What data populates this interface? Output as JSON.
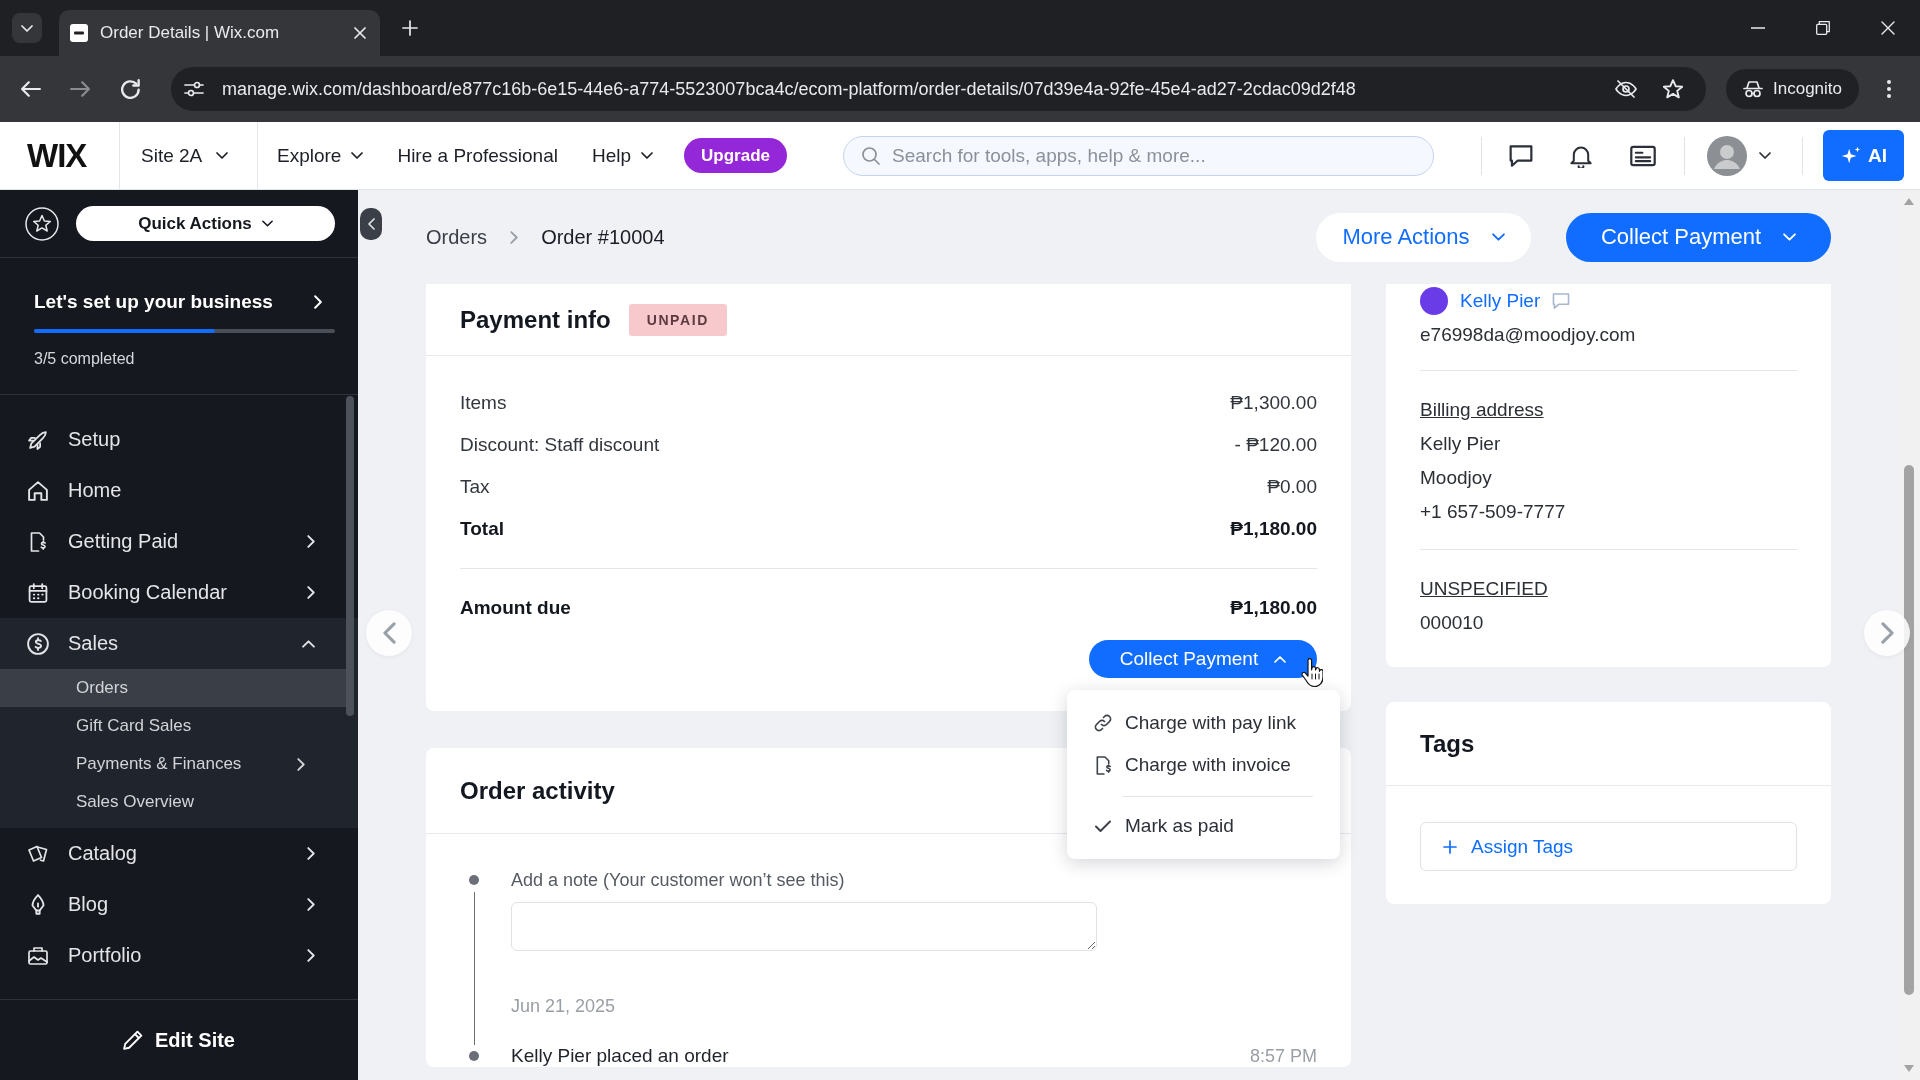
{
  "browser": {
    "tabs": [
      {
        "title": "Order Details | Wix.com",
        "selected": true
      }
    ],
    "url": "manage.wix.com/dashboard/e877c16b-6e15-44e6-a774-5523007bca4c/ecom-platform/order-details/07d39e4a-92fe-45e4-ad27-2cdac09d2f48",
    "profile": "Incognito"
  },
  "header": {
    "logo": "WIX",
    "site": {
      "label": "Site 2A",
      "has_menu": true
    },
    "nav": [
      {
        "label": "Explore",
        "has_menu": true
      },
      {
        "label": "Hire a Professional",
        "has_menu": false
      },
      {
        "label": "Help",
        "has_menu": true
      }
    ],
    "upgrade": "Upgrade",
    "search": {
      "placeholder": "Search for tools, apps, help & more..."
    },
    "ai": "AI"
  },
  "sidebar": {
    "quick_actions": "Quick Actions",
    "setup": {
      "title": "Let's set up your business",
      "level": 0.6,
      "progress": "3/5 completed"
    },
    "items": [
      {
        "label": "Setup",
        "selected": false,
        "has_submenu": false,
        "expanded": false
      },
      {
        "label": "Home",
        "selected": false,
        "has_submenu": false,
        "expanded": false
      },
      {
        "label": "Getting Paid",
        "selected": false,
        "has_submenu": true,
        "expanded": false
      },
      {
        "label": "Booking Calendar",
        "selected": false,
        "has_submenu": true,
        "expanded": false
      },
      {
        "label": "Sales",
        "selected": false,
        "has_submenu": true,
        "expanded": true,
        "children": [
          {
            "label": "Orders",
            "selected": true,
            "has_submenu": false
          },
          {
            "label": "Gift Card Sales",
            "selected": false,
            "has_submenu": false
          },
          {
            "label": "Payments & Finances",
            "selected": false,
            "has_submenu": true
          },
          {
            "label": "Sales Overview",
            "selected": false,
            "has_submenu": false
          }
        ]
      },
      {
        "label": "Catalog",
        "selected": false,
        "has_submenu": true,
        "expanded": false
      },
      {
        "label": "Blog",
        "selected": false,
        "has_submenu": true,
        "expanded": false
      },
      {
        "label": "Portfolio",
        "selected": false,
        "has_submenu": true,
        "expanded": false
      }
    ],
    "footer": "Edit Site"
  },
  "breadcrumb": [
    "Orders",
    "Order #10004"
  ],
  "page_actions": {
    "more": "More Actions",
    "collect": "Collect Payment"
  },
  "payment_info": {
    "title": "Payment info",
    "status": "UNPAID",
    "rows": [
      {
        "label": "Items",
        "value": "₱1,300.00",
        "bold": false
      },
      {
        "label": "Discount: Staff discount",
        "value": "- ₱120.00",
        "bold": false
      },
      {
        "label": "Tax",
        "value": "₱0.00",
        "bold": false
      },
      {
        "label": "Total",
        "value": "₱1,180.00",
        "bold": true
      }
    ],
    "amount_due": {
      "label": "Amount due",
      "value": "₱1,180.00"
    },
    "collect": {
      "label": "Collect Payment",
      "expanded": true,
      "menu": [
        {
          "label": "Charge with pay link",
          "separator_before": false
        },
        {
          "label": "Charge with invoice",
          "separator_before": false
        },
        {
          "label": "Mark as paid",
          "separator_before": true
        }
      ]
    }
  },
  "order_activity": {
    "title": "Order activity",
    "note": {
      "label": "Add a note (Your customer won’t see this)"
    },
    "date": "Jun 21, 2025",
    "events": [
      {
        "text": "Kelly Pier placed an order",
        "time": "8:57 PM"
      }
    ]
  },
  "customer": {
    "name": "Kelly Pier",
    "email": "e76998da@moodjoy.com",
    "sections": [
      {
        "title": "Billing address",
        "lines": [
          "Kelly Pier",
          "Moodjoy",
          "+1 657-509-7777"
        ]
      },
      {
        "title": "UNSPECIFIED",
        "lines": [
          "000010"
        ]
      }
    ]
  },
  "tags": {
    "title": "Tags",
    "assign": "Assign Tags"
  }
}
